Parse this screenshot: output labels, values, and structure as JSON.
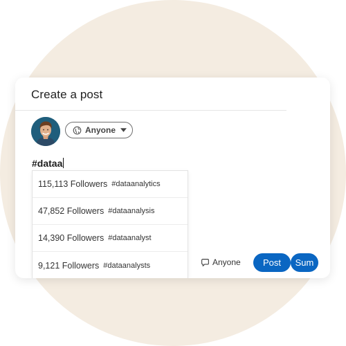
{
  "composer": {
    "title": "Create a post",
    "audience_label": "Anyone",
    "text": "#dataa"
  },
  "suggestions": [
    {
      "followers": "115,113 Followers",
      "tag": "#dataanalytics"
    },
    {
      "followers": "47,852 Followers",
      "tag": "#dataanalysis"
    },
    {
      "followers": "14,390 Followers",
      "tag": "#dataanalyst"
    },
    {
      "followers": "9,121 Followers",
      "tag": "#dataanalysts"
    }
  ],
  "footer": {
    "comment_audience": "Anyone",
    "post_label": "Post",
    "sum_label": "Sum"
  },
  "colors": {
    "accent": "#0a66c2",
    "background_circle": "#f4ece1"
  },
  "icons": [
    "globe-icon",
    "chevron-down-icon",
    "comment-icon"
  ]
}
